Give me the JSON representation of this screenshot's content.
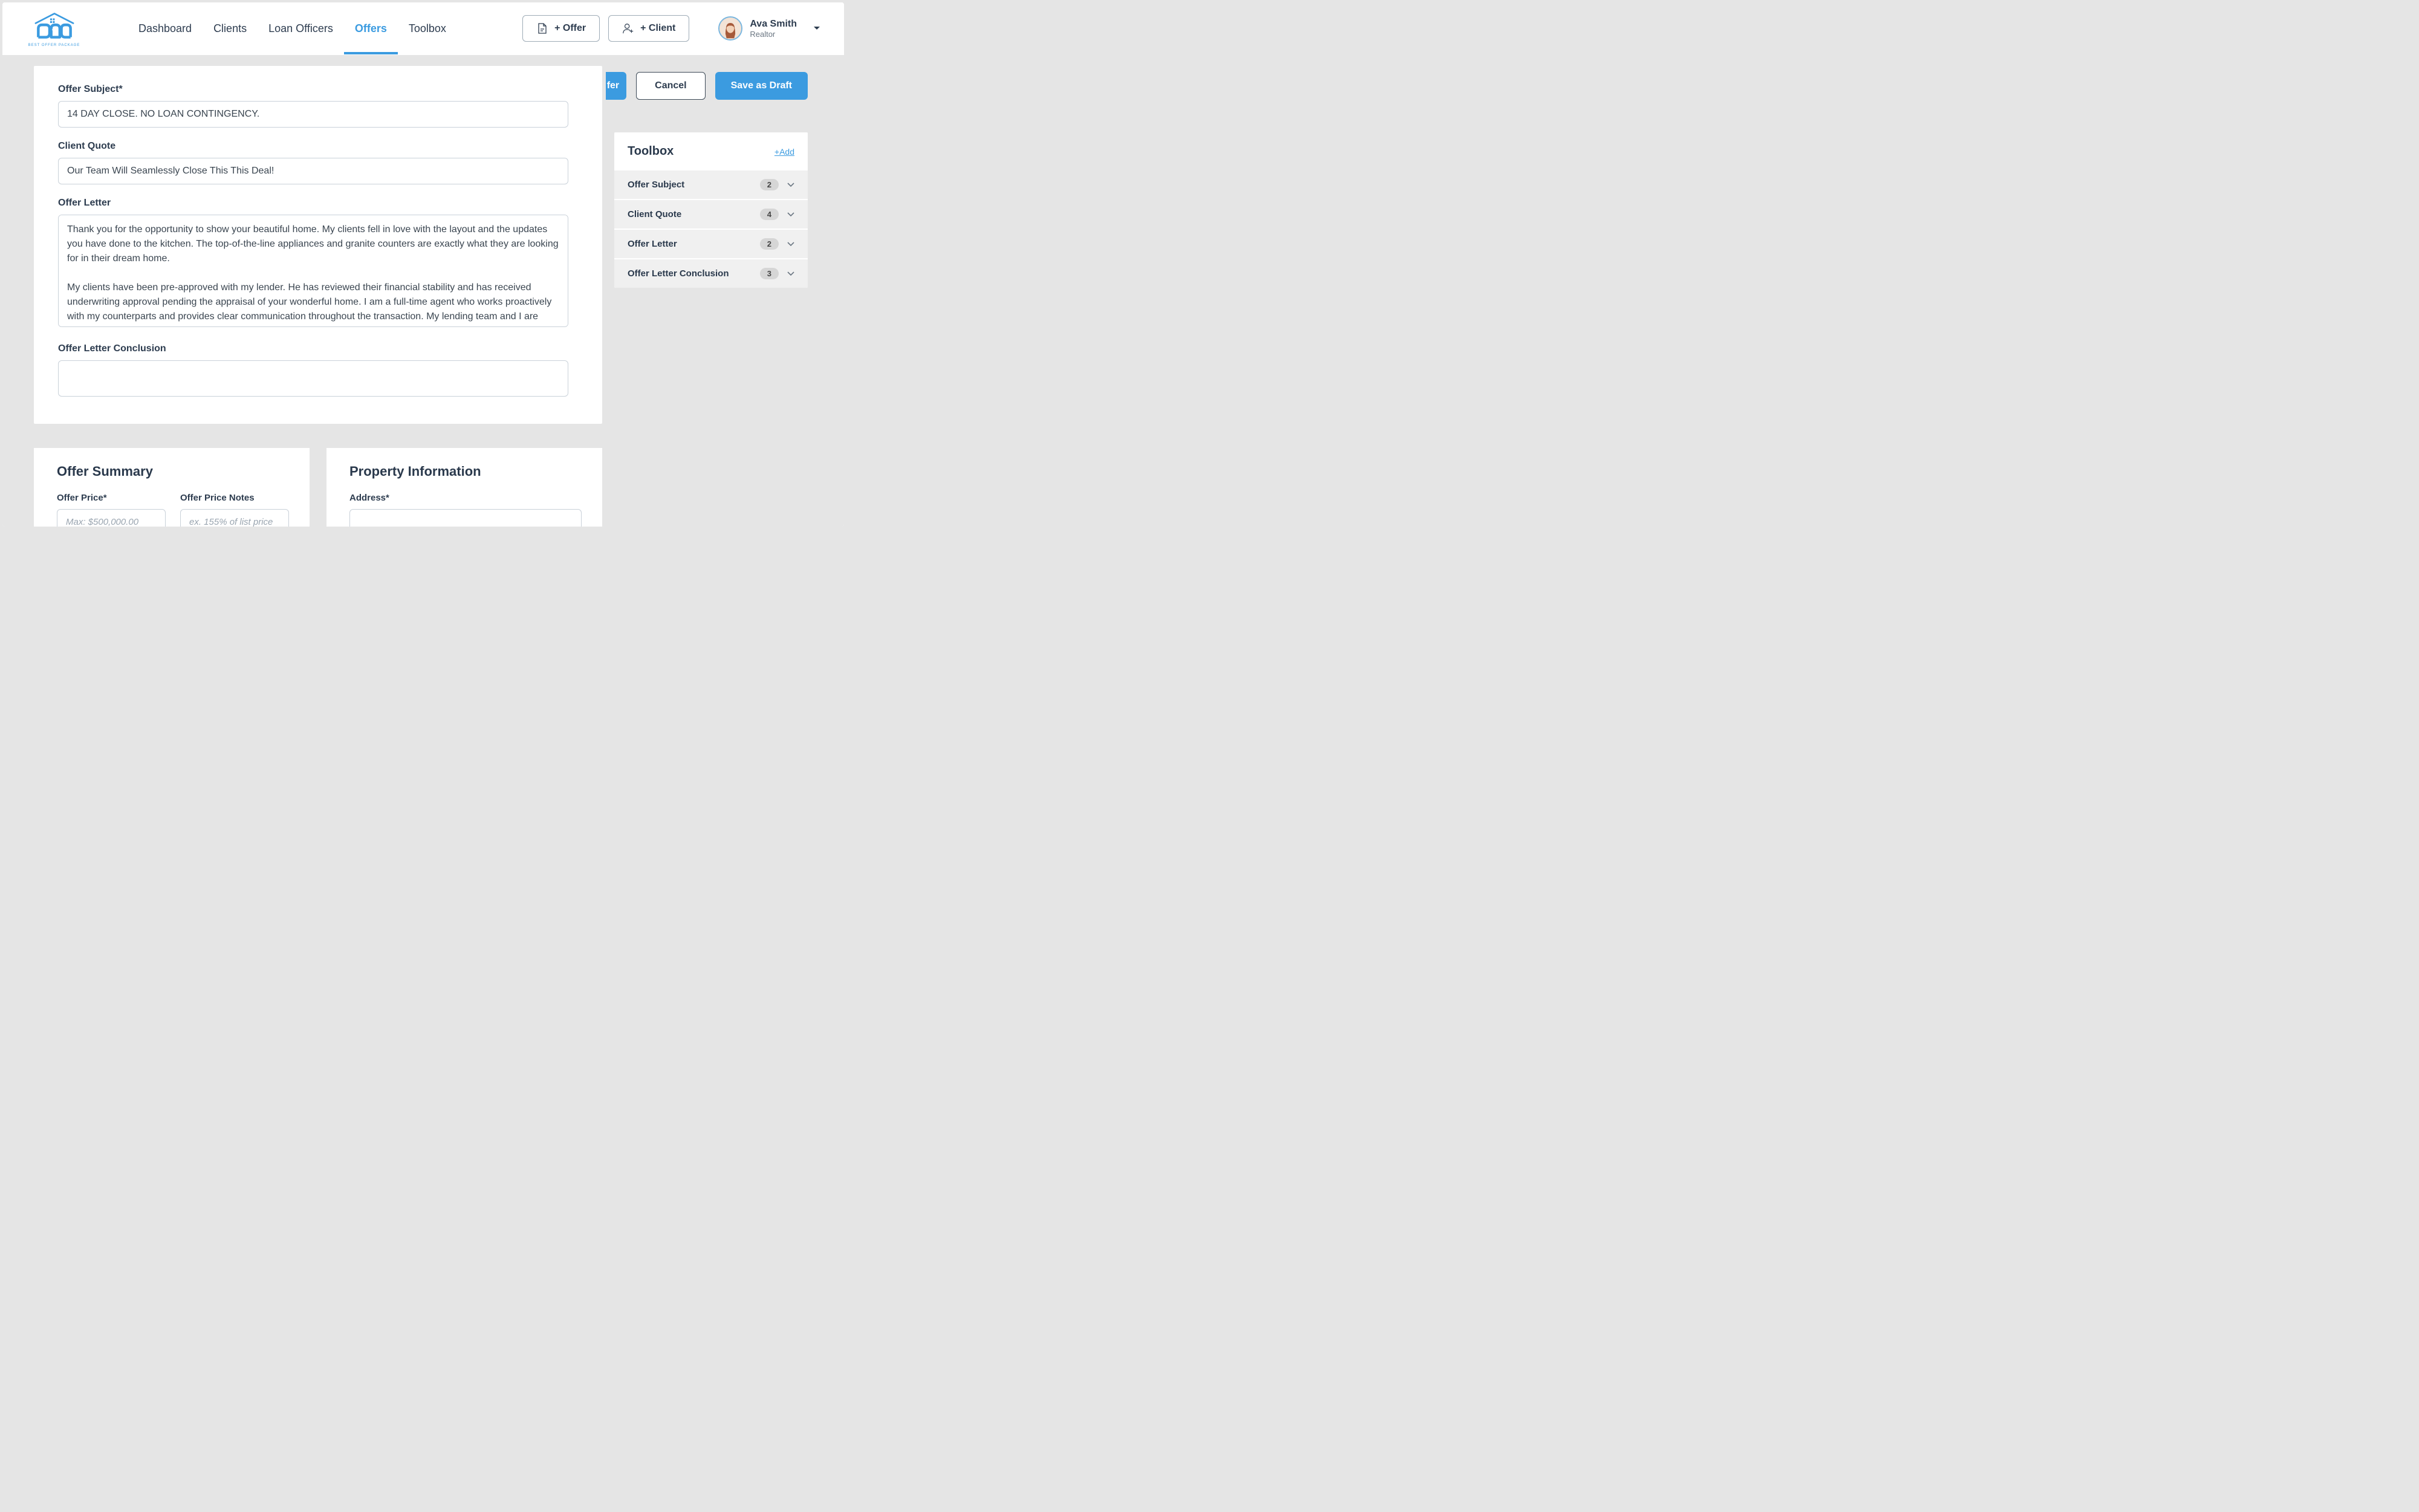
{
  "logo": {
    "subtitle": "BEST OFFER PACKAGE"
  },
  "nav": {
    "links": [
      {
        "label": "Dashboard"
      },
      {
        "label": "Clients"
      },
      {
        "label": "Loan Officers"
      },
      {
        "label": "Offers",
        "active": true
      },
      {
        "label": "Toolbox"
      }
    ],
    "offer_button": "+ Offer",
    "client_button": "+ Client"
  },
  "user": {
    "name": "Ava Smith",
    "role": "Realtor"
  },
  "action_buttons": {
    "left_partial": "fer",
    "cancel": "Cancel",
    "save_draft": "Save as Draft"
  },
  "form": {
    "offer_subject": {
      "label": "Offer Subject*",
      "value": "14 DAY CLOSE. NO LOAN CONTINGENCY."
    },
    "client_quote": {
      "label": "Client Quote",
      "value": "Our Team Will Seamlessly Close This This Deal!"
    },
    "offer_letter": {
      "label": "Offer Letter",
      "value": "Thank you for the opportunity to show your beautiful home. My clients fell in love with the layout and the updates you have done to the kitchen. The top-of-the-line appliances and granite counters are exactly what they are looking for in their dream home.\n\nMy clients have been pre-approved with my lender. He has reviewed their financial stability and has received underwriting approval pending the appraisal of your wonderful home. I am a full-time agent who works proactively with my counterparts and provides clear communication throughout the transaction. My lending team and I are confident that you will be happy with the outcome when selecting our strong offer."
    },
    "offer_letter_conclusion": {
      "label": "Offer Letter Conclusion",
      "value": ""
    }
  },
  "summary_card": {
    "title": "Offer Summary",
    "offer_price": {
      "label": "Offer Price*",
      "placeholder": "Max: $500,000.00"
    },
    "offer_price_notes": {
      "label": "Offer Price Notes",
      "placeholder": "ex. 155% of list price"
    }
  },
  "property_card": {
    "title": "Property Information",
    "address": {
      "label": "Address*"
    }
  },
  "toolbox": {
    "title": "Toolbox",
    "add_link": "+Add",
    "rows": [
      {
        "label": "Offer Subject",
        "count": "2"
      },
      {
        "label": "Client Quote",
        "count": "4"
      },
      {
        "label": "Offer Letter",
        "count": "2"
      },
      {
        "label": "Offer Letter Conclusion",
        "count": "3"
      }
    ]
  }
}
